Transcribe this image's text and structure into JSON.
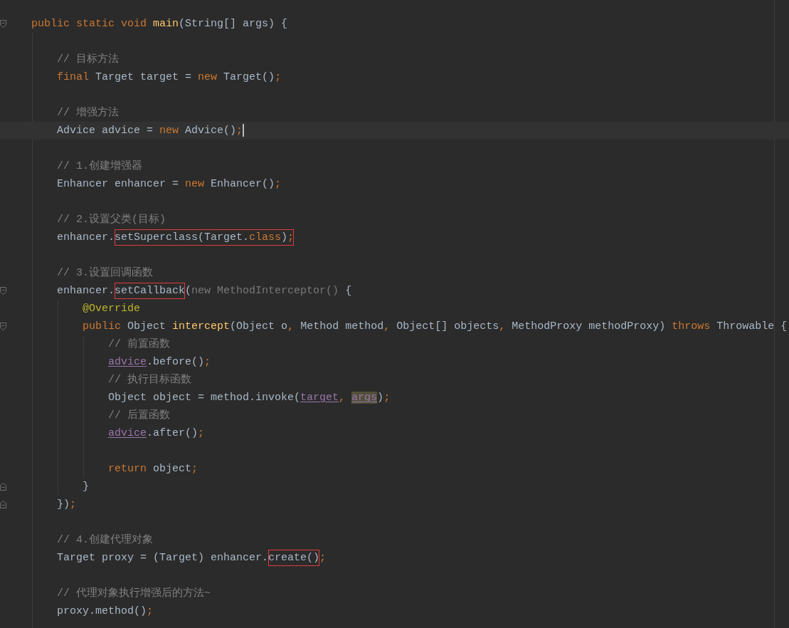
{
  "editor": {
    "lines": [
      {
        "fold_open": true,
        "tokens": [
          {
            "kind": "keyword",
            "text": "public static void"
          },
          {
            "kind": "method",
            "text": "main"
          },
          {
            "kind": "plain",
            "text": "(String[] args) {"
          }
        ],
        "children": [
          {
            "kind": "blank"
          },
          {
            "tokens": [
              {
                "kind": "comment",
                "text": "// 目标方法"
              }
            ]
          },
          {
            "tokens": [
              {
                "kind": "keyword",
                "text": "final"
              },
              {
                "kind": "plain",
                "text": "Target target ="
              },
              {
                "kind": "keyword",
                "text": "new"
              },
              {
                "kind": "plain",
                "text": "Target()"
              },
              {
                "kind": "punct",
                "text": ";"
              }
            ]
          },
          {
            "kind": "blank"
          },
          {
            "tokens": [
              {
                "kind": "comment",
                "text": "// 增强方法"
              }
            ]
          },
          {
            "caret": true,
            "tokens": [
              {
                "kind": "plain",
                "text": "Advice advice ="
              },
              {
                "kind": "keyword",
                "text": "new"
              },
              {
                "kind": "plain",
                "text": "Advice()"
              },
              {
                "kind": "punct",
                "text": ";"
              }
            ]
          },
          {
            "kind": "blank"
          },
          {
            "tokens": [
              {
                "kind": "comment",
                "text": "// 1.创建增强器"
              }
            ]
          },
          {
            "tokens": [
              {
                "kind": "plain",
                "text": "Enhancer enhancer ="
              },
              {
                "kind": "keyword",
                "text": "new"
              },
              {
                "kind": "plain",
                "text": "Enhancer()"
              },
              {
                "kind": "punct",
                "text": ";"
              }
            ]
          },
          {
            "kind": "blank"
          },
          {
            "tokens": [
              {
                "kind": "comment",
                "text": "// 2.设置父类(目标)"
              }
            ]
          },
          {
            "tokens": [
              {
                "kind": "plain",
                "text": "enhancer."
              },
              {
                "kind": "box",
                "tokens": [
                  {
                    "kind": "plain",
                    "text": "setSuperclass(Target."
                  },
                  {
                    "kind": "keyword",
                    "text": "class"
                  },
                  {
                    "kind": "plain",
                    "text": ")"
                  },
                  {
                    "kind": "punct",
                    "text": ";"
                  }
                ]
              }
            ]
          },
          {
            "kind": "blank"
          },
          {
            "tokens": [
              {
                "kind": "comment",
                "text": "// 3.设置回调函数"
              }
            ]
          },
          {
            "fold_open": true,
            "tokens": [
              {
                "kind": "plain",
                "text": "enhancer."
              },
              {
                "kind": "box",
                "tokens": [
                  {
                    "kind": "plain",
                    "text": "setCallback"
                  }
                ]
              },
              {
                "kind": "plain",
                "text": "("
              },
              {
                "kind": "dim",
                "text": "new MethodInterceptor()"
              },
              {
                "kind": "plain",
                "text": "{"
              }
            ],
            "children": [
              {
                "tokens": [
                  {
                    "kind": "annotation",
                    "text": "@Override"
                  }
                ]
              },
              {
                "fold_open": true,
                "tokens": [
                  {
                    "kind": "keyword",
                    "text": "public"
                  },
                  {
                    "kind": "plain",
                    "text": "Object"
                  },
                  {
                    "kind": "method",
                    "text": "intercept"
                  },
                  {
                    "kind": "plain",
                    "text": "(Object o"
                  },
                  {
                    "kind": "punct",
                    "text": ","
                  },
                  {
                    "kind": "plain",
                    "text": "Method method"
                  },
                  {
                    "kind": "punct",
                    "text": ","
                  },
                  {
                    "kind": "plain",
                    "text": "Object[] objects"
                  },
                  {
                    "kind": "punct",
                    "text": ","
                  },
                  {
                    "kind": "plain",
                    "text": "MethodProxy methodProxy)"
                  },
                  {
                    "kind": "keyword",
                    "text": "throws"
                  },
                  {
                    "kind": "plain",
                    "text": "Throwable {"
                  }
                ],
                "children": [
                  {
                    "tokens": [
                      {
                        "kind": "comment",
                        "text": "// 前置函数"
                      }
                    ]
                  },
                  {
                    "tokens": [
                      {
                        "kind": "field",
                        "text": "advice"
                      },
                      {
                        "kind": "plain",
                        "text": ".before()"
                      },
                      {
                        "kind": "punct",
                        "text": ";"
                      }
                    ]
                  },
                  {
                    "tokens": [
                      {
                        "kind": "comment",
                        "text": "// 执行目标函数"
                      }
                    ]
                  },
                  {
                    "tokens": [
                      {
                        "kind": "plain",
                        "text": "Object object = method.invoke("
                      },
                      {
                        "kind": "field",
                        "text": "target"
                      },
                      {
                        "kind": "punct",
                        "text": ","
                      },
                      {
                        "kind": "field",
                        "text": "args",
                        "usage": true
                      },
                      {
                        "kind": "plain",
                        "text": ")"
                      },
                      {
                        "kind": "punct",
                        "text": ";"
                      }
                    ]
                  },
                  {
                    "tokens": [
                      {
                        "kind": "comment",
                        "text": "// 后置函数"
                      }
                    ]
                  },
                  {
                    "tokens": [
                      {
                        "kind": "field",
                        "text": "advice"
                      },
                      {
                        "kind": "plain",
                        "text": ".after()"
                      },
                      {
                        "kind": "punct",
                        "text": ";"
                      }
                    ]
                  },
                  {
                    "kind": "blank"
                  },
                  {
                    "tokens": [
                      {
                        "kind": "keyword",
                        "text": "return"
                      },
                      {
                        "kind": "plain",
                        "text": "object"
                      },
                      {
                        "kind": "punct",
                        "text": ";"
                      }
                    ]
                  }
                ]
              },
              {
                "fold_close": true,
                "tokens": [
                  {
                    "kind": "plain",
                    "text": "}"
                  }
                ]
              }
            ]
          },
          {
            "fold_close": true,
            "tokens": [
              {
                "kind": "plain",
                "text": "})"
              },
              {
                "kind": "punct",
                "text": ";"
              }
            ]
          },
          {
            "kind": "blank"
          },
          {
            "tokens": [
              {
                "kind": "comment",
                "text": "// 4.创建代理对象"
              }
            ]
          },
          {
            "tokens": [
              {
                "kind": "plain",
                "text": "Target proxy = (Target) enhancer."
              },
              {
                "kind": "box",
                "tokens": [
                  {
                    "kind": "plain",
                    "text": "create()"
                  }
                ]
              },
              {
                "kind": "punct",
                "text": ";"
              }
            ]
          },
          {
            "kind": "blank"
          },
          {
            "tokens": [
              {
                "kind": "comment",
                "text": "// 代理对象执行增强后的方法~"
              }
            ]
          },
          {
            "tokens": [
              {
                "kind": "plain",
                "text": "proxy.method()"
              },
              {
                "kind": "punct",
                "text": ";"
              }
            ]
          }
        ]
      }
    ]
  }
}
